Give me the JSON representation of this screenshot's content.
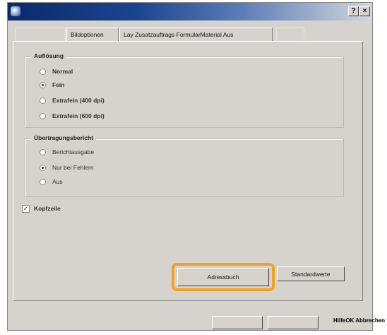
{
  "window": {
    "title": "",
    "help_button": "?",
    "close_button": "×"
  },
  "tabs": [
    {
      "label": ""
    },
    {
      "label": "Bildoptionen"
    },
    {
      "label": "Lay Zusatzauftrags FormularMaterial Aus"
    },
    {
      "label": ""
    }
  ],
  "aufloesung": {
    "legend": "Auflösung",
    "options": [
      {
        "label": "Normal",
        "checked": false
      },
      {
        "label": "Fein",
        "checked": true
      },
      {
        "label": "Extrafein (400 dpi)",
        "checked": false
      },
      {
        "label": "Extrafein (600 dpi)",
        "checked": false
      }
    ]
  },
  "uebertragungsbericht": {
    "legend": "Übertragungsbericht",
    "options": [
      {
        "label": "Berichtausgabe",
        "checked": false
      },
      {
        "label": "Nur bei Fehlern",
        "checked": true
      },
      {
        "label": "Aus",
        "checked": false
      }
    ]
  },
  "kopfzeile": {
    "label": "Kopfzeile",
    "checked": true
  },
  "buttons": {
    "adressbuch": "Adressbuch",
    "standardwerte": "Standardwerte",
    "ok": "",
    "abbrechen": ""
  },
  "hint_text": "HilfeOK Abbrechen",
  "colors": {
    "highlight": "#f5a11c",
    "dialog_bg": "#d6d3ce"
  },
  "icons": {
    "radio_checked": "radio-dot",
    "checkbox_checked": "check-mark"
  }
}
